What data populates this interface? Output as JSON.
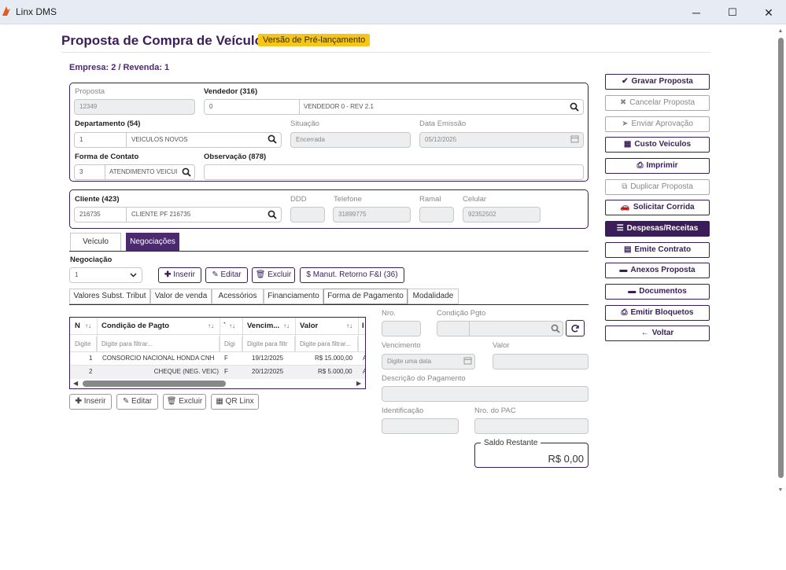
{
  "window": {
    "title": "Linx DMS",
    "minimize": "─",
    "maximize": "☐",
    "close": "✕"
  },
  "header": {
    "title": "Proposta de Compra de Veículo",
    "badge": "Versão de Pré-lançamento",
    "empresa": "Empresa: 2 / Revenda: 1"
  },
  "proposta": {
    "proposta_label": "Proposta",
    "proposta_value": "12349",
    "vendedor_label": "Vendedor (316)",
    "vendedor_code": "0",
    "vendedor_name": "VENDEDOR 0 - REV 2.1",
    "departamento_label": "Departamento (54)",
    "departamento_code": "1",
    "departamento_name": "VEICULOS NOVOS",
    "situacao_label": "Situação",
    "situacao_value": "Encerrada",
    "data_emissao_label": "Data Emissão",
    "data_emissao_value": "05/12/2025",
    "forma_contato_label": "Forma de Contato",
    "forma_contato_code": "3",
    "forma_contato_name": "ATENDIMENTO VEICUI",
    "observacao_label": "Observação (878)",
    "observacao_value": ""
  },
  "cliente": {
    "cliente_label": "Cliente (423)",
    "cliente_code": "216735",
    "cliente_name": "CLIENTE PF 216735",
    "ddd_label": "DDD",
    "ddd_value": "",
    "telefone_label": "Telefone",
    "telefone_value": "31899775",
    "ramal_label": "Ramal",
    "ramal_value": "",
    "celular_label": "Celular",
    "celular_value": "92352502"
  },
  "actions": [
    {
      "label": "Gravar Proposta",
      "icon": "✔",
      "state": "normal"
    },
    {
      "label": "Cancelar Proposta",
      "icon": "✖",
      "state": "disabled"
    },
    {
      "label": "Enviar Aprovação",
      "icon": "➤",
      "state": "disabled"
    },
    {
      "label": "Custo Veiculos",
      "icon": "▦",
      "state": "normal"
    },
    {
      "label": "Imprimir",
      "icon": "⎙",
      "state": "normal"
    },
    {
      "label": "Duplicar Proposta",
      "icon": "⧉",
      "state": "disabled"
    },
    {
      "label": "Solicitar Corrida",
      "icon": "🚗",
      "state": "normal"
    },
    {
      "label": "Despesas/Receitas",
      "icon": "☰",
      "state": "active"
    },
    {
      "label": "Emite Contrato",
      "icon": "▤",
      "state": "normal"
    },
    {
      "label": "Anexos Proposta",
      "icon": "▬",
      "state": "normal"
    },
    {
      "label": "Documentos",
      "icon": "▬",
      "state": "normal"
    },
    {
      "label": "Emitir Bloquetos",
      "icon": "⎙",
      "state": "normal"
    },
    {
      "label": "Voltar",
      "icon": "←",
      "state": "normal"
    }
  ],
  "tabs": {
    "veiculo": "Veículo",
    "negociacoes": "Negociações"
  },
  "negociacao": {
    "label": "Negociação",
    "selected": "1",
    "inserir": "Inserir",
    "editar": "Editar",
    "excluir": "Excluir",
    "manut": "Manut. Retorno F&I (36)"
  },
  "subtabs": [
    "Valores Subst. Tribut",
    "Valor de venda",
    "Acessórios",
    "Financiamento",
    "Forma de Pagamento",
    "Modalidade"
  ],
  "grid": {
    "headers": {
      "n": "N",
      "condicao": "Condição de Pagto",
      "t": "`",
      "vencimento": "Vencim...",
      "valor": "Valor",
      "extra": "I"
    },
    "filters": {
      "n": "Digite",
      "condicao": "Digite para filtrar...",
      "t": "Digi",
      "vencimento": "Digite para filtr",
      "valor": "Digite para filtrar...",
      "extra": ""
    },
    "rows": [
      {
        "n": "1",
        "condicao": "CONSORCIO NACIONAL HONDA CNH",
        "t": "F",
        "vencimento": "19/12/2025",
        "valor": "R$ 15.000,00",
        "extra": "A"
      },
      {
        "n": "2",
        "condicao": "CHEQUE (NEG. VEIC)",
        "t": "F",
        "vencimento": "20/12/2025",
        "valor": "R$ 5.000,00",
        "extra": "A"
      }
    ]
  },
  "grid_buttons": {
    "inserir": "Inserir",
    "editar": "Editar",
    "excluir": "Excluir",
    "qr": "QR Linx"
  },
  "pagamento": {
    "nro_label": "Nro.",
    "nro_value": "",
    "condicao_label": "Condição Pgto",
    "condicao_code": "",
    "condicao_name": "",
    "vencimento_label": "Vencimento",
    "vencimento_placeholder": "Digite uma data",
    "valor_label": "Valor",
    "valor_value": "",
    "descricao_label": "Descrição do Pagamento",
    "descricao_value": "",
    "identificacao_label": "Identificação",
    "identificacao_value": "",
    "pac_label": "Nro. do PAC",
    "pac_value": "",
    "saldo_label": "Saldo Restante",
    "saldo_value": "R$ 0,00"
  },
  "colors": {
    "primary": "#3b1e59",
    "badge": "#f5c518",
    "titlebar": "#e6ebf4"
  }
}
